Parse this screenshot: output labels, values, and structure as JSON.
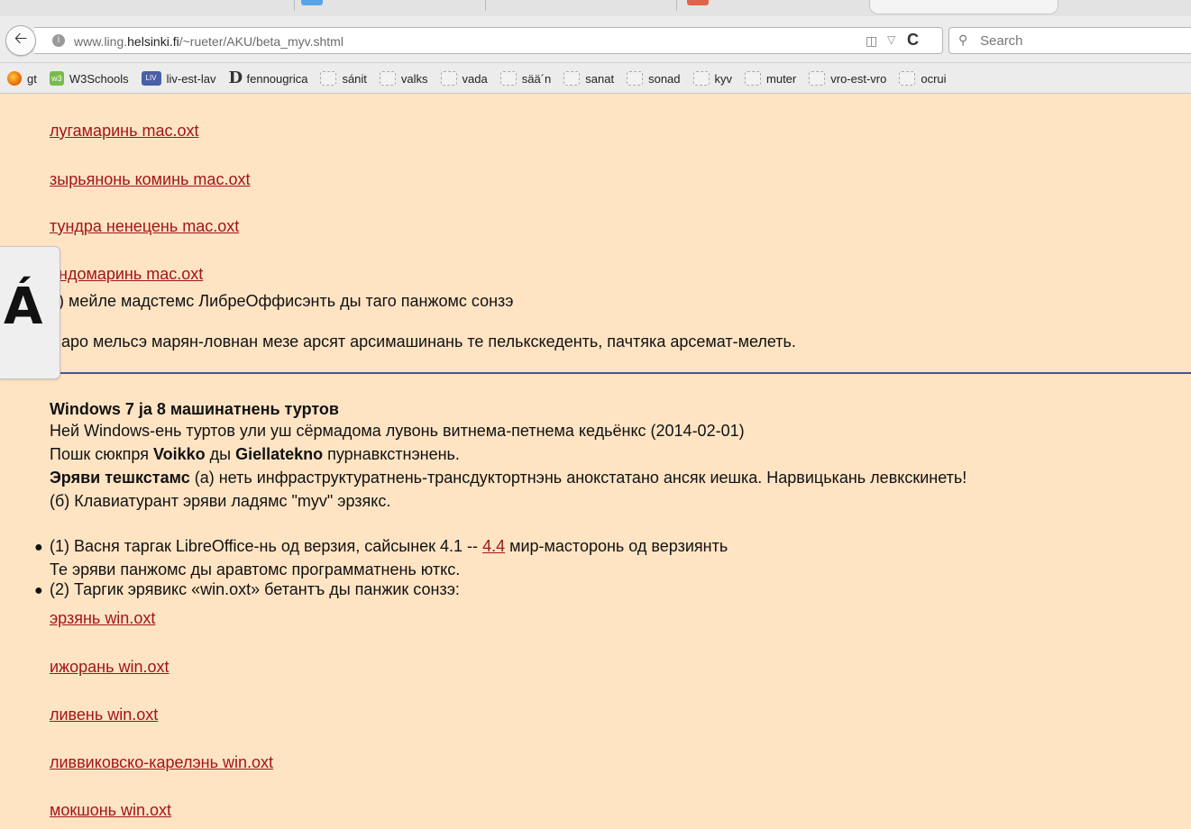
{
  "browser": {
    "url_prefix": "www.ling.",
    "url_domain": "helsinki.fi",
    "url_path": "/~rueter/AKU/beta_myv.shtml",
    "search_placeholder": "Search",
    "back_icon": "arrow-left-icon",
    "reload_icon": "reload-icon"
  },
  "bookmarks": [
    {
      "label": "gt",
      "icon": "firefox-icon"
    },
    {
      "label": "W3Schools",
      "icon": "w3schools-icon"
    },
    {
      "label": "liv-est-lav",
      "icon": "liv-icon",
      "icon_text": "LIV"
    },
    {
      "label": "fennougrica",
      "icon": "d-icon",
      "icon_text": "D"
    },
    {
      "label": "sánit",
      "icon": "page-icon"
    },
    {
      "label": "valks",
      "icon": "page-icon"
    },
    {
      "label": "vada",
      "icon": "page-icon"
    },
    {
      "label": "sää´n",
      "icon": "page-icon"
    },
    {
      "label": "sanat",
      "icon": "page-icon"
    },
    {
      "label": "sonad",
      "icon": "page-icon"
    },
    {
      "label": "kyv",
      "icon": "page-icon"
    },
    {
      "label": "muter",
      "icon": "page-icon"
    },
    {
      "label": "vro-est-vro",
      "icon": "page-icon"
    },
    {
      "label": "ocrui",
      "icon": "page-icon"
    }
  ],
  "side_widget": {
    "letter": "Á"
  },
  "mac_links": [
    "лугамаринь mac.oxt",
    "зырьянонь коминь mac.oxt",
    "тундра ненецень mac.oxt",
    "андомаринь mac.oxt"
  ],
  "step3": "3) мейле мадстемс ЛибреОффисэнть ды таго панжомс сонзэ",
  "note": "Паро мельсэ марян-ловнан мезе арсят арсимашинань те пелькскеденть, пачтяка арсемат-мелеть.",
  "windows": {
    "heading": "Windows 7 ja 8 машинатнень туртов",
    "line1": "Ней Windows-ень туртов ули уш сёрмадома лувонь витнема-петнема кедьёнкс (2014-02-01)",
    "line2_a": "Пошк сюкпря ",
    "line2_b": "Voikko",
    "line2_c": " ды ",
    "line2_d": "Giellatekno",
    "line2_e": " пурнавкстнэнень.",
    "line3_bold": "Эряви тешкстамс",
    "line3_rest": " (а) неть инфраструктуратнень-трансдуктортнэнь анокстатано ансяк иешка. Нарвицькань левкскинеть!",
    "line4": "(б) Клавиатурант эряви ладямс \"myv\" эрзякс.",
    "bullet1_a": "(1) Васня таргак LibreOffice-нь од верзия, сайсынек 4.1 -- ",
    "bullet1_link": "4.4",
    "bullet1_b": " мир-масторонь од верзиянть",
    "bullet1_line2": "Те эряви панжомс ды аравтомс программатнень юткс.",
    "bullet2": "(2) Таргик эрявикс «win.oxt» бетантъ ды панжик сонзэ:",
    "win_links": [
      "эрзянь win.oxt",
      "ижорань win.oxt",
      "ливень win.oxt",
      "ливвиковско-карелэнь win.oxt",
      "мокшонь win.oxt"
    ]
  }
}
